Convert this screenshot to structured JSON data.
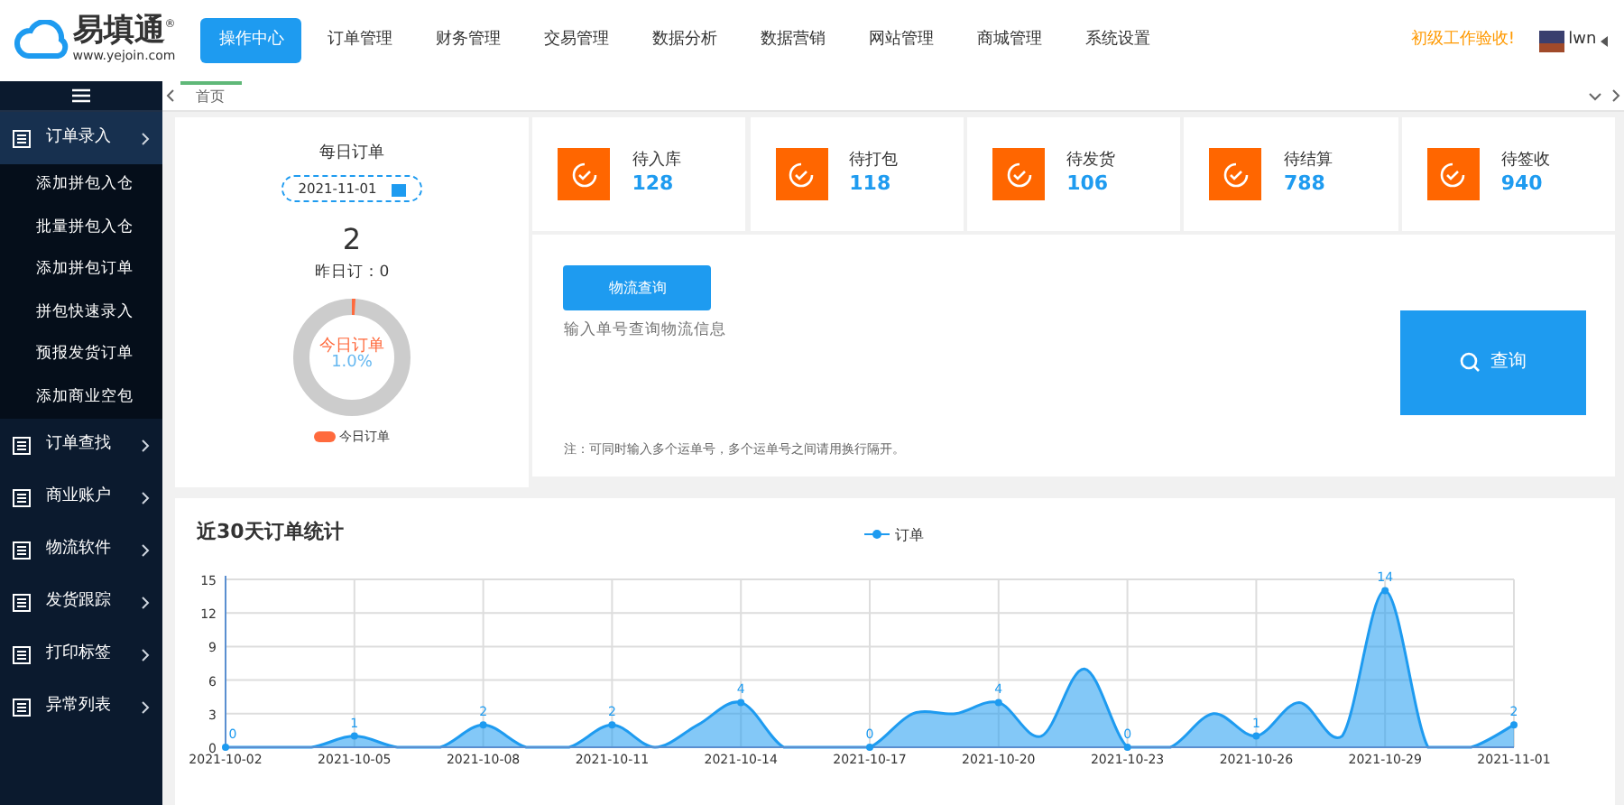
{
  "header": {
    "logo_text": "易填通",
    "logo_mark": "®",
    "logo_url": "www.yejoin.com",
    "nav": [
      {
        "label": "操作中心",
        "selected": true
      },
      {
        "label": "订单管理",
        "selected": false
      },
      {
        "label": "财务管理",
        "selected": false
      },
      {
        "label": "交易管理",
        "selected": false
      },
      {
        "label": "数据分析",
        "selected": false
      },
      {
        "label": "数据营销",
        "selected": false
      },
      {
        "label": "网站管理",
        "selected": false
      },
      {
        "label": "商城管理",
        "selected": false
      },
      {
        "label": "系统设置",
        "selected": false
      }
    ],
    "notice": "初级工作验收!",
    "user": "lwn"
  },
  "tabs": [
    {
      "label": "首页",
      "selected": true
    }
  ],
  "sidebar": {
    "items": [
      {
        "label": "订单录入",
        "expanded": true,
        "children": [
          {
            "label": "添加拼包入仓"
          },
          {
            "label": "批量拼包入仓"
          },
          {
            "label": "添加拼包订单"
          },
          {
            "label": "拼包快速录入"
          },
          {
            "label": "预报发货订单"
          },
          {
            "label": "添加商业空包"
          }
        ]
      },
      {
        "label": "订单查找",
        "expanded": false
      },
      {
        "label": "商业账户",
        "expanded": false
      },
      {
        "label": "物流软件",
        "expanded": false
      },
      {
        "label": "发货跟踪",
        "expanded": false
      },
      {
        "label": "打印标签",
        "expanded": false
      },
      {
        "label": "异常列表",
        "expanded": false
      }
    ]
  },
  "daily": {
    "title": "每日订单",
    "date": "2021-11-01",
    "count": "2",
    "yesterday": "昨日订：0",
    "donut_label": "今日订单",
    "donut_percent": "1.0%",
    "level": 0.01,
    "legend": "今日订单"
  },
  "stats": [
    {
      "label": "待入库",
      "value": "128"
    },
    {
      "label": "待打包",
      "value": "118"
    },
    {
      "label": "待发货",
      "value": "106"
    },
    {
      "label": "待结算",
      "value": "788"
    },
    {
      "label": "待签收",
      "value": "940"
    }
  ],
  "query": {
    "tab_button": "物流查询",
    "placeholder": "输入单号查询物流信息",
    "note": "注：可同时输入多个运单号，多个运单号之间请用换行隔开。",
    "search_button": "查询"
  },
  "chart": {
    "title": "近30天订单统计",
    "chart_data": {
      "type": "area",
      "x": [
        "2021-10-02",
        "2021-10-03",
        "2021-10-04",
        "2021-10-05",
        "2021-10-06",
        "2021-10-07",
        "2021-10-08",
        "2021-10-09",
        "2021-10-10",
        "2021-10-11",
        "2021-10-12",
        "2021-10-13",
        "2021-10-14",
        "2021-10-15",
        "2021-10-16",
        "2021-10-17",
        "2021-10-18",
        "2021-10-19",
        "2021-10-20",
        "2021-10-21",
        "2021-10-22",
        "2021-10-23",
        "2021-10-24",
        "2021-10-25",
        "2021-10-26",
        "2021-10-27",
        "2021-10-28",
        "2021-10-29",
        "2021-10-30",
        "2021-10-31",
        "2021-11-01"
      ],
      "series": [
        {
          "name": "订单",
          "color": "#1e9bf0",
          "values": [
            0,
            0,
            0,
            1,
            0,
            0,
            2,
            0,
            0,
            2,
            0,
            2,
            4,
            0,
            0,
            0,
            3,
            3,
            4,
            1,
            7,
            0,
            0,
            3,
            1,
            4,
            1,
            14,
            0,
            0,
            2
          ]
        }
      ],
      "xlim": [
        "2021-10-02",
        "2021-11-01"
      ],
      "grid": true,
      "ylim": [
        0,
        15
      ],
      "yticks": [
        0,
        3,
        6,
        9,
        12,
        15
      ],
      "xticks": [
        "2021-10-02",
        "2021-10-05",
        "2021-10-08",
        "2021-10-11",
        "2021-10-14",
        "2021-10-17",
        "2021-10-20",
        "2021-10-23",
        "2021-10-26",
        "2021-10-29",
        "2021-11-01"
      ],
      "value_labels": [
        "0",
        null,
        null,
        "1",
        null,
        null,
        "2",
        null,
        null,
        "2",
        null,
        null,
        "4",
        null,
        null,
        "0",
        null,
        null,
        "4",
        null,
        null,
        "0",
        null,
        null,
        "1",
        null,
        null,
        "14",
        null,
        null,
        "2"
      ]
    }
  }
}
